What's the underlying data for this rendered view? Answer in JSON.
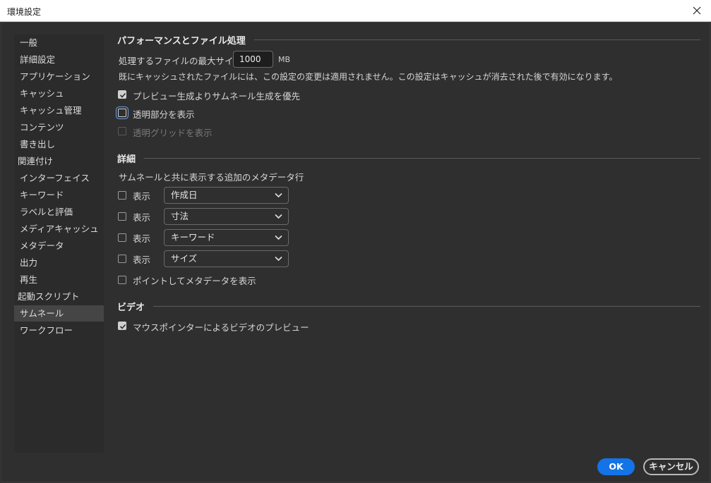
{
  "window": {
    "title": "環境設定"
  },
  "sidebar": {
    "items": [
      {
        "label": "一般"
      },
      {
        "label": "詳細設定"
      },
      {
        "label": "アプリケーション"
      },
      {
        "label": "キャッシュ"
      },
      {
        "label": "キャッシュ管理"
      },
      {
        "label": "コンテンツ"
      },
      {
        "label": "書き出し"
      },
      {
        "label": "関連付け"
      },
      {
        "label": "インターフェイス"
      },
      {
        "label": "キーワード"
      },
      {
        "label": "ラベルと評価"
      },
      {
        "label": "メディアキャッシュ"
      },
      {
        "label": "メタデータ"
      },
      {
        "label": "出力"
      },
      {
        "label": "再生"
      },
      {
        "label": "起動スクリプト"
      },
      {
        "label": "サムネール"
      },
      {
        "label": "ワークフロー"
      }
    ],
    "selected": "サムネール"
  },
  "performance": {
    "heading": "パフォーマンスとファイル処理",
    "max_size_label": "処理するファイルの最大サイズ",
    "max_size_value": "1000",
    "max_size_unit": "MB",
    "note": "既にキャッシュされたファイルには、この設定の変更は適用されません。この設定はキャッシュが消去された後で有効になります。",
    "prefer_preview": {
      "label": "プレビュー生成よりサムネール生成を優先",
      "checked": true
    },
    "show_transparency": {
      "label": "透明部分を表示",
      "checked": false
    },
    "show_transparency_grid": {
      "label": "透明グリッドを表示",
      "checked": false,
      "enabled": false
    }
  },
  "details": {
    "heading": "詳細",
    "description": "サムネールと共に表示する追加のメタデータ行",
    "rows": [
      {
        "label": "表示",
        "checked": false,
        "value": "作成日"
      },
      {
        "label": "表示",
        "checked": false,
        "value": "寸法"
      },
      {
        "label": "表示",
        "checked": false,
        "value": "キーワード"
      },
      {
        "label": "表示",
        "checked": false,
        "value": "サイズ"
      }
    ],
    "hover_metadata": {
      "label": "ポイントしてメタデータを表示",
      "checked": false
    }
  },
  "video": {
    "heading": "ビデオ",
    "hover_preview": {
      "label": "マウスポインターによるビデオのプレビュー",
      "checked": true
    }
  },
  "buttons": {
    "ok": "OK",
    "cancel": "キャンセル"
  },
  "colors": {
    "accent": "#1473e6",
    "background": "#2f2f2f",
    "sidebar": "#2b2b2b",
    "selected": "#454545"
  }
}
